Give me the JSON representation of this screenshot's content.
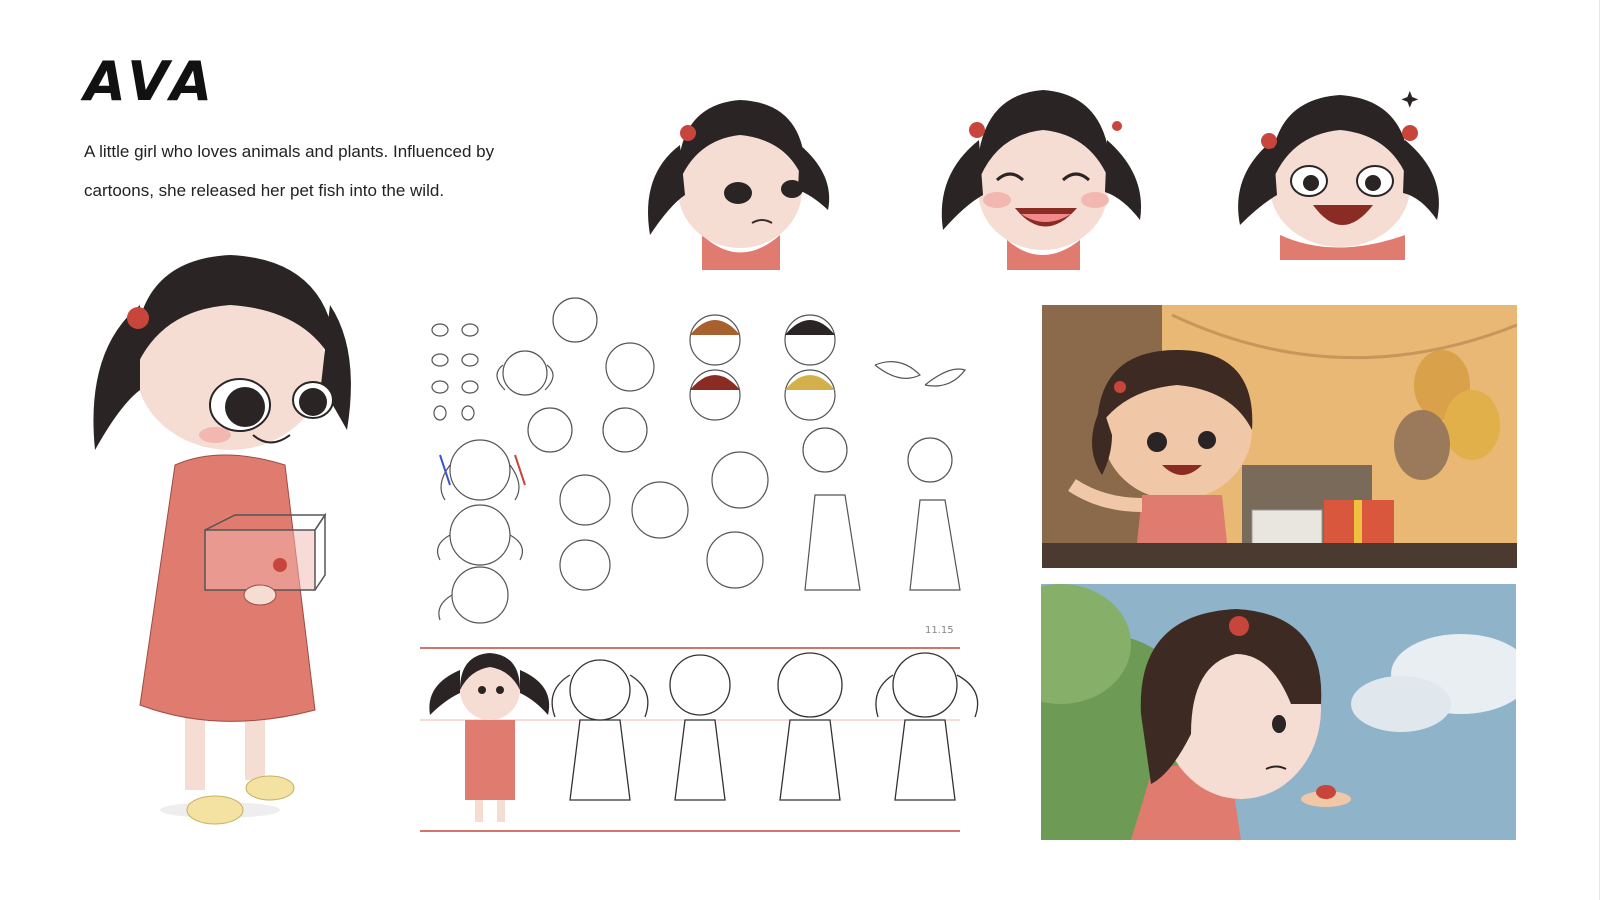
{
  "character": {
    "name": "AVA",
    "description": "A little girl who loves animals and plants. Influenced by cartoons, she released her pet fish into the wild."
  },
  "sketch_sheet": {
    "signature": "11.15"
  },
  "colors": {
    "hair": "#2b2424",
    "skin": "#f6ddd3",
    "dress": "#e07b6f",
    "bow": "#c8453b",
    "sky": "#8fb3c9",
    "room": "#e9b874"
  }
}
